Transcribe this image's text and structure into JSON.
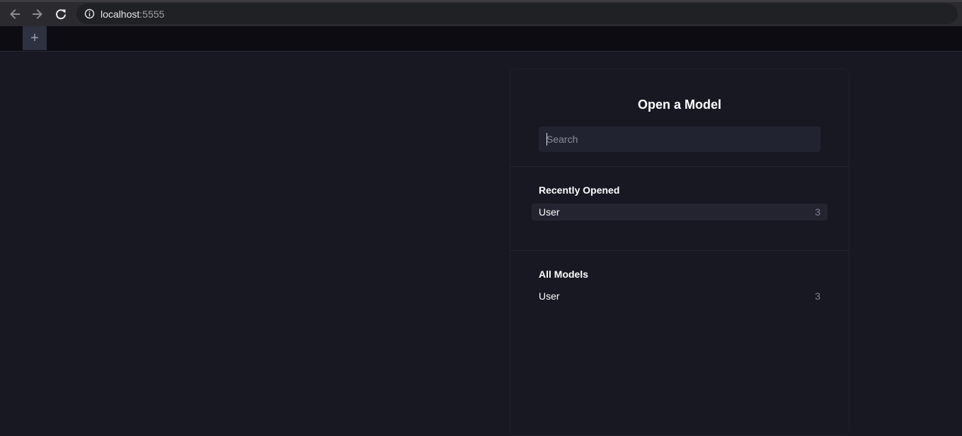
{
  "browser": {
    "url_host": "localhost",
    "url_port": ":5555"
  },
  "tabs": {
    "add_label": "+"
  },
  "open_model": {
    "title": "Open a Model",
    "search_placeholder": "Search",
    "search_value": "",
    "recently_opened": {
      "heading": "Recently Opened",
      "items": [
        {
          "name": "User",
          "count": "3"
        }
      ]
    },
    "all_models": {
      "heading": "All Models",
      "items": [
        {
          "name": "User",
          "count": "3"
        }
      ]
    }
  }
}
